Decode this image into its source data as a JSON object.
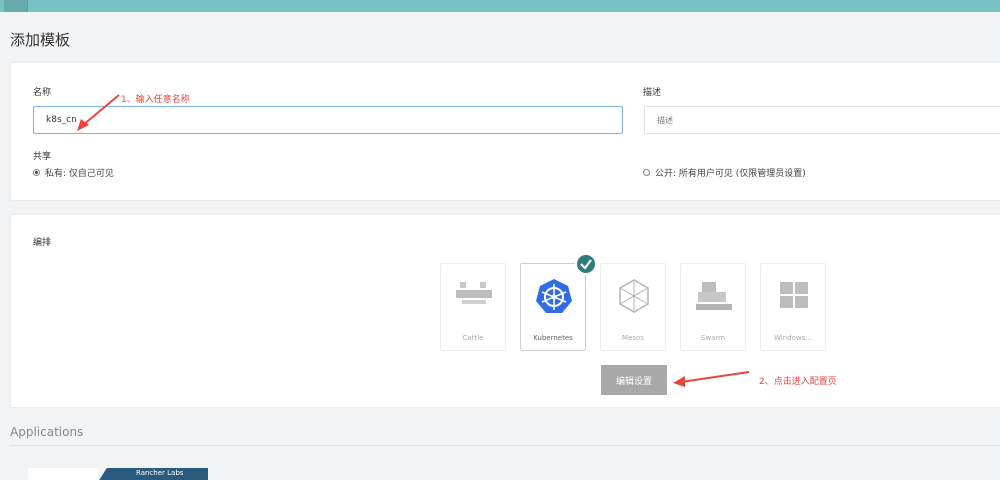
{
  "page": {
    "title": "添加模板"
  },
  "form": {
    "name_label": "名称",
    "name_value": "k8s_cn",
    "desc_label": "描述",
    "desc_placeholder": "描述",
    "share_label": "共享",
    "share_private": "私有: 仅自己可见",
    "share_public": "公开: 所有用户可见 (仅限管理员设置)"
  },
  "orchestration": {
    "label": "编排",
    "options": [
      {
        "label": "Cattle",
        "selected": false,
        "icon": "cattle-icon"
      },
      {
        "label": "Kubernetes",
        "selected": true,
        "icon": "kubernetes-icon"
      },
      {
        "label": "Mesos",
        "selected": false,
        "icon": "mesos-icon"
      },
      {
        "label": "Swarm",
        "selected": false,
        "icon": "swarm-icon"
      },
      {
        "label": "Windows...",
        "selected": false,
        "icon": "windows-icon"
      }
    ],
    "edit_button": "编辑设置"
  },
  "annotations": {
    "step1": "1、输入任意名称",
    "step2": "2、点击进入配置页"
  },
  "applications": {
    "heading": "Applications",
    "ribbon": "Rancher Labs"
  },
  "colors": {
    "accent": "#78c2c5",
    "kubernetes": "#326ce5",
    "check": "#2e7d78",
    "annotation": "#e8453c"
  }
}
